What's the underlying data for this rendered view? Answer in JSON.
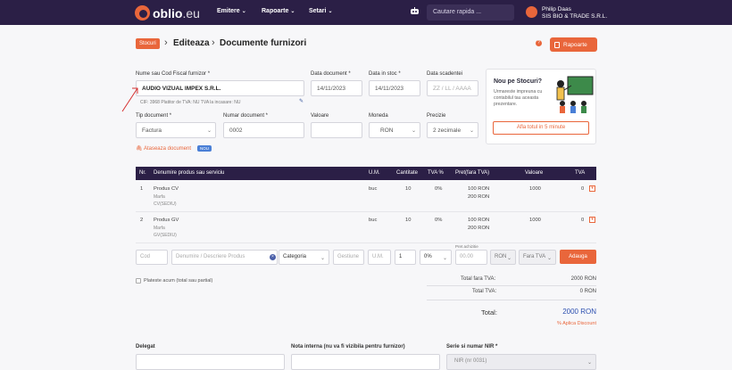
{
  "nav": {
    "logo_main": "oblio",
    "logo_suffix": ".eu",
    "menu": [
      "Emitere",
      "Rapoarte",
      "Setari"
    ],
    "search_placeholder": "Cautare rapida ...",
    "user_name": "Philip Daas",
    "company": "SIS BIO & TRADE S.R.L."
  },
  "breadcrumb": {
    "badge": "Stocuri",
    "step1": "Editeaza",
    "step2": "Documente furnizori"
  },
  "header_button": "Rapoarte",
  "form": {
    "supplier_label": "Nume sau Cod Fiscal furnizor *",
    "supplier_value": "AUDIO VIZUAL IMPEX S.R.L.",
    "supplier_info": "CIF: 3968   Platitor de TVA: NU   TVA la incasare: NU",
    "doc_date_label": "Data document *",
    "doc_date_value": "14/11/2023",
    "stock_date_label": "Data in stoc *",
    "stock_date_value": "14/11/2023",
    "due_date_label": "Data scadentei",
    "due_date_placeholder": "ZZ / LL / AAAA",
    "doc_type_label": "Tip document *",
    "doc_type_value": "Factura",
    "doc_number_label": "Numar document *",
    "doc_number_value": "0002",
    "value_label": "Valoare",
    "currency_label": "Moneda",
    "currency_value": "RON",
    "precision_label": "Precizie",
    "precision_value": "2 zecimale",
    "attach_label": "Ataseaza document",
    "attach_badge": "NOU"
  },
  "promo_card": {
    "title": "Nou pe Stocuri?",
    "body": "Urmareste impreuna cu contabilul tau aceasta prezentare.",
    "button": "Afla totul in 5 minute"
  },
  "table": {
    "headers": [
      "Nr.",
      "Denumire produs sau serviciu",
      "U.M.",
      "Cantitate",
      "TVA %",
      "Pret(fara TVA)",
      "Valoare",
      "TVA"
    ],
    "rows": [
      {
        "nr": "1",
        "name": "Produs CV",
        "sub1": "Marfa",
        "sub2": "CV(SEDIU)",
        "um": "buc",
        "qty": "10",
        "vat": "0%",
        "price1": "100 RON",
        "price2": "200 RON",
        "value": "1000",
        "vat_val": "0"
      },
      {
        "nr": "2",
        "name": "Produs GV",
        "sub1": "Marfa",
        "sub2": "GV(SEDIU)",
        "um": "buc",
        "qty": "10",
        "vat": "0%",
        "price1": "100 RON",
        "price2": "200 RON",
        "value": "1000",
        "vat_val": "0"
      }
    ]
  },
  "add_row": {
    "code": "Cod",
    "name": "Denumire / Descriere Produs",
    "category": "Categoria",
    "management": "Gestiune",
    "um": "U.M.",
    "qty": "1",
    "vat": "0%",
    "price_label": "Pret achizitie",
    "price": "00.00",
    "currency": "RON",
    "vat_mode": "Fara TVA",
    "add_button": "Adauga"
  },
  "paid_checkbox": "Plateste acum (total sau partial)",
  "totals": {
    "without_vat_label": "Total fara TVA:",
    "without_vat_value": "2000 RON",
    "vat_label": "Total TVA:",
    "vat_value": "0 RON",
    "total_label": "Total:",
    "total_value": "2000 RON",
    "discount": "% Aplica Discount"
  },
  "bottom": {
    "delegate_label": "Delegat",
    "internal_note_label": "Nota interna (nu va fi vizibila pentru furnizor)",
    "series_label": "Serie si numar NIR *",
    "series_value": "NIR (nr 0031)"
  },
  "colors": {
    "nav_bg": "#2b1f46",
    "accent": "#e9663b",
    "link_blue": "#2d50b0"
  }
}
